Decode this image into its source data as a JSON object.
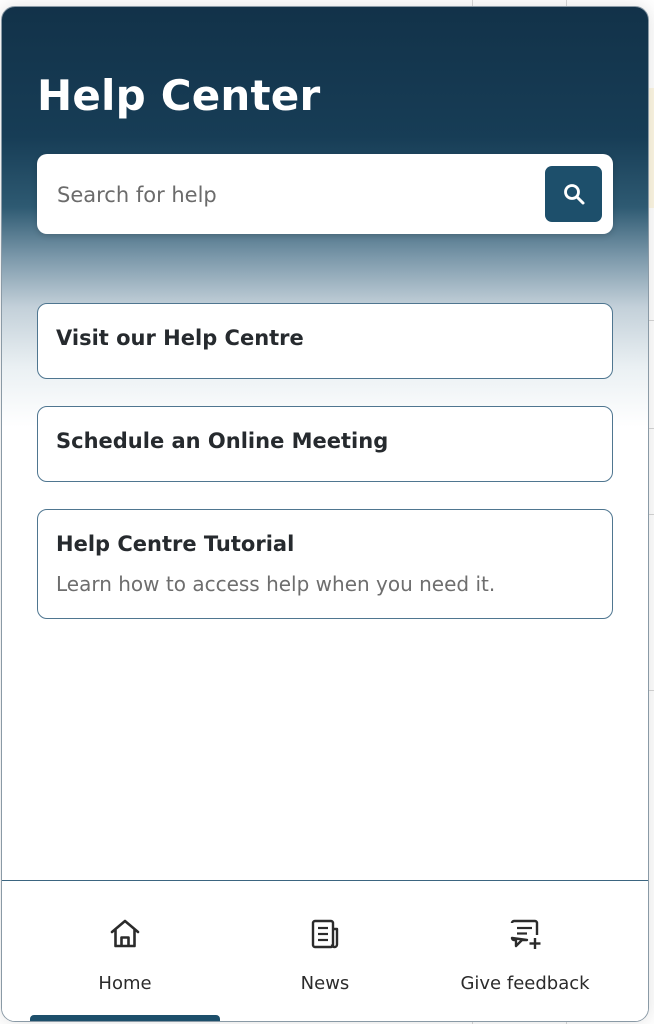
{
  "header": {
    "title": "Help Center"
  },
  "search": {
    "placeholder": "Search for help",
    "button_icon": "search-icon"
  },
  "cards": [
    {
      "title": "Visit our Help Centre"
    },
    {
      "title": "Schedule an Online Meeting"
    },
    {
      "title": "Help Centre Tutorial",
      "description": "Learn how to access help when you need it."
    }
  ],
  "nav": {
    "items": [
      {
        "label": "Home",
        "icon": "home-icon",
        "active": true
      },
      {
        "label": "News",
        "icon": "news-icon",
        "active": false
      },
      {
        "label": "Give feedback",
        "icon": "feedback-icon",
        "active": false
      }
    ]
  },
  "colors": {
    "header_dark": "#123249",
    "accent": "#1d4f6b",
    "card_border": "#4f7690"
  }
}
